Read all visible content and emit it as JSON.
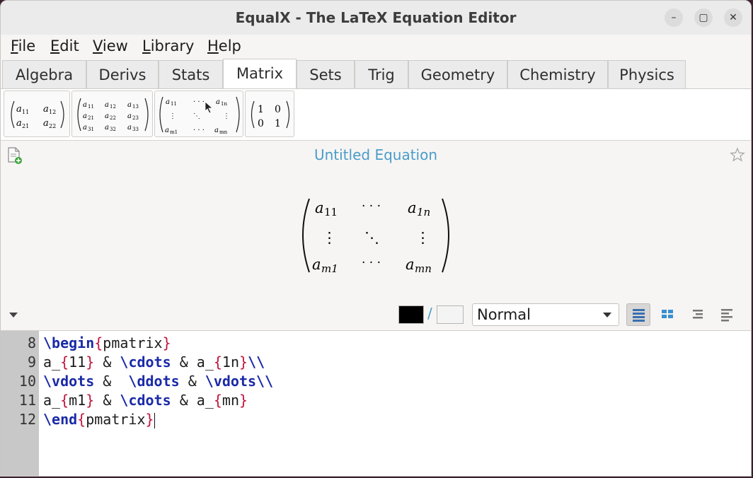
{
  "window": {
    "title": "EqualX - The LaTeX Equation Editor",
    "controls": [
      "–",
      "▢",
      "✕"
    ]
  },
  "menu": [
    {
      "label": "File",
      "mnemonic": "F",
      "rest": "ile"
    },
    {
      "label": "Edit",
      "mnemonic": "E",
      "rest": "dit"
    },
    {
      "label": "View",
      "mnemonic": "V",
      "rest": "iew"
    },
    {
      "label": "Library",
      "mnemonic": "L",
      "rest": "ibrary"
    },
    {
      "label": "Help",
      "mnemonic": "H",
      "rest": "elp"
    }
  ],
  "tabs": [
    "Algebra",
    "Derivs",
    "Stats",
    "Matrix",
    "Sets",
    "Trig",
    "Geometry",
    "Chemistry",
    "Physics"
  ],
  "active_tab": "Matrix",
  "palette": {
    "m2x2": {
      "a": "a",
      "s11": "11",
      "s12": "12",
      "s21": "21",
      "s22": "22"
    },
    "m3x3": {
      "s": [
        "11",
        "12",
        "13",
        "21",
        "22",
        "23",
        "31",
        "32",
        "33"
      ]
    },
    "mgen": {
      "s11": "11",
      "s1n": "1n",
      "sm1": "m1",
      "smn": "mn"
    },
    "identity": {
      "v": [
        "1",
        "0",
        "0",
        "1"
      ]
    }
  },
  "equation": {
    "title": "Untitled Equation",
    "cells": {
      "base": "a",
      "s11": "11",
      "s1n": "1n",
      "sm1": "m1",
      "smn": "mn",
      "cdots": "· · ·",
      "ddots": "⋱",
      "vdots": "⋮"
    }
  },
  "format_bar": {
    "fg_color": "#000000",
    "bg_color": "#f4f4f4",
    "slash": "/",
    "environment": "Normal"
  },
  "editor": {
    "line_numbers": [
      "8",
      "9",
      "10",
      "11",
      "12"
    ],
    "lines": [
      "\\begin{pmatrix}",
      "a_{11} & \\cdots & a_{1n}\\\\",
      "\\vdots &  \\ddots & \\vdots\\\\",
      "a_{m1} & \\cdots & a_{mn}",
      "\\end{pmatrix}"
    ]
  },
  "colors": {
    "keyword": "#1a2aa8",
    "brace": "#c0143c",
    "title_accent": "#4a9cc9"
  }
}
